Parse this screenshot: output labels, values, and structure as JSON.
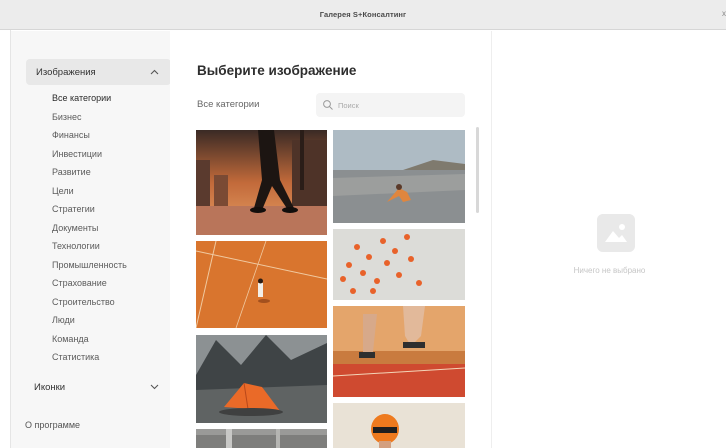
{
  "window": {
    "title": "Галерея S+Консалтинг",
    "close_glyph": "x"
  },
  "sidebar": {
    "section_images": {
      "label": "Изображения",
      "chevron": "up-chevron-icon"
    },
    "categories": [
      "Все категории",
      "Бизнес",
      "Финансы",
      "Инвестиции",
      "Развитие",
      "Цели",
      "Стратегии",
      "Документы",
      "Технологии",
      "Промышленность",
      "Страхование",
      "Строительство",
      "Люди",
      "Команда",
      "Статистика"
    ],
    "active_category": "Все категории",
    "section_icons": {
      "label": "Иконки",
      "chevron": "down-chevron-icon"
    },
    "about": "О программе"
  },
  "main": {
    "title": "Выберите изображение",
    "current_category": "Все категории",
    "search": {
      "placeholder": "Поиск",
      "value": ""
    },
    "thumbnails": [
      "person-walking-city-photo",
      "woman-stretching-beach-photo",
      "tennis-court-aerial-photo",
      "orange-pills-pattern-photo",
      "tent-in-mountains-photo",
      "sprinter-starting-blocks-photo",
      "rooftop-building-photo",
      "person-orange-helmet-photo"
    ]
  },
  "preview": {
    "empty_text": "Ничего не выбрано",
    "icon": "image-placeholder-icon"
  },
  "colors": {
    "sidebar_bg": "#f7f7f7",
    "accent_orange": "#e8622a",
    "muted_text": "#c6c6c6"
  }
}
